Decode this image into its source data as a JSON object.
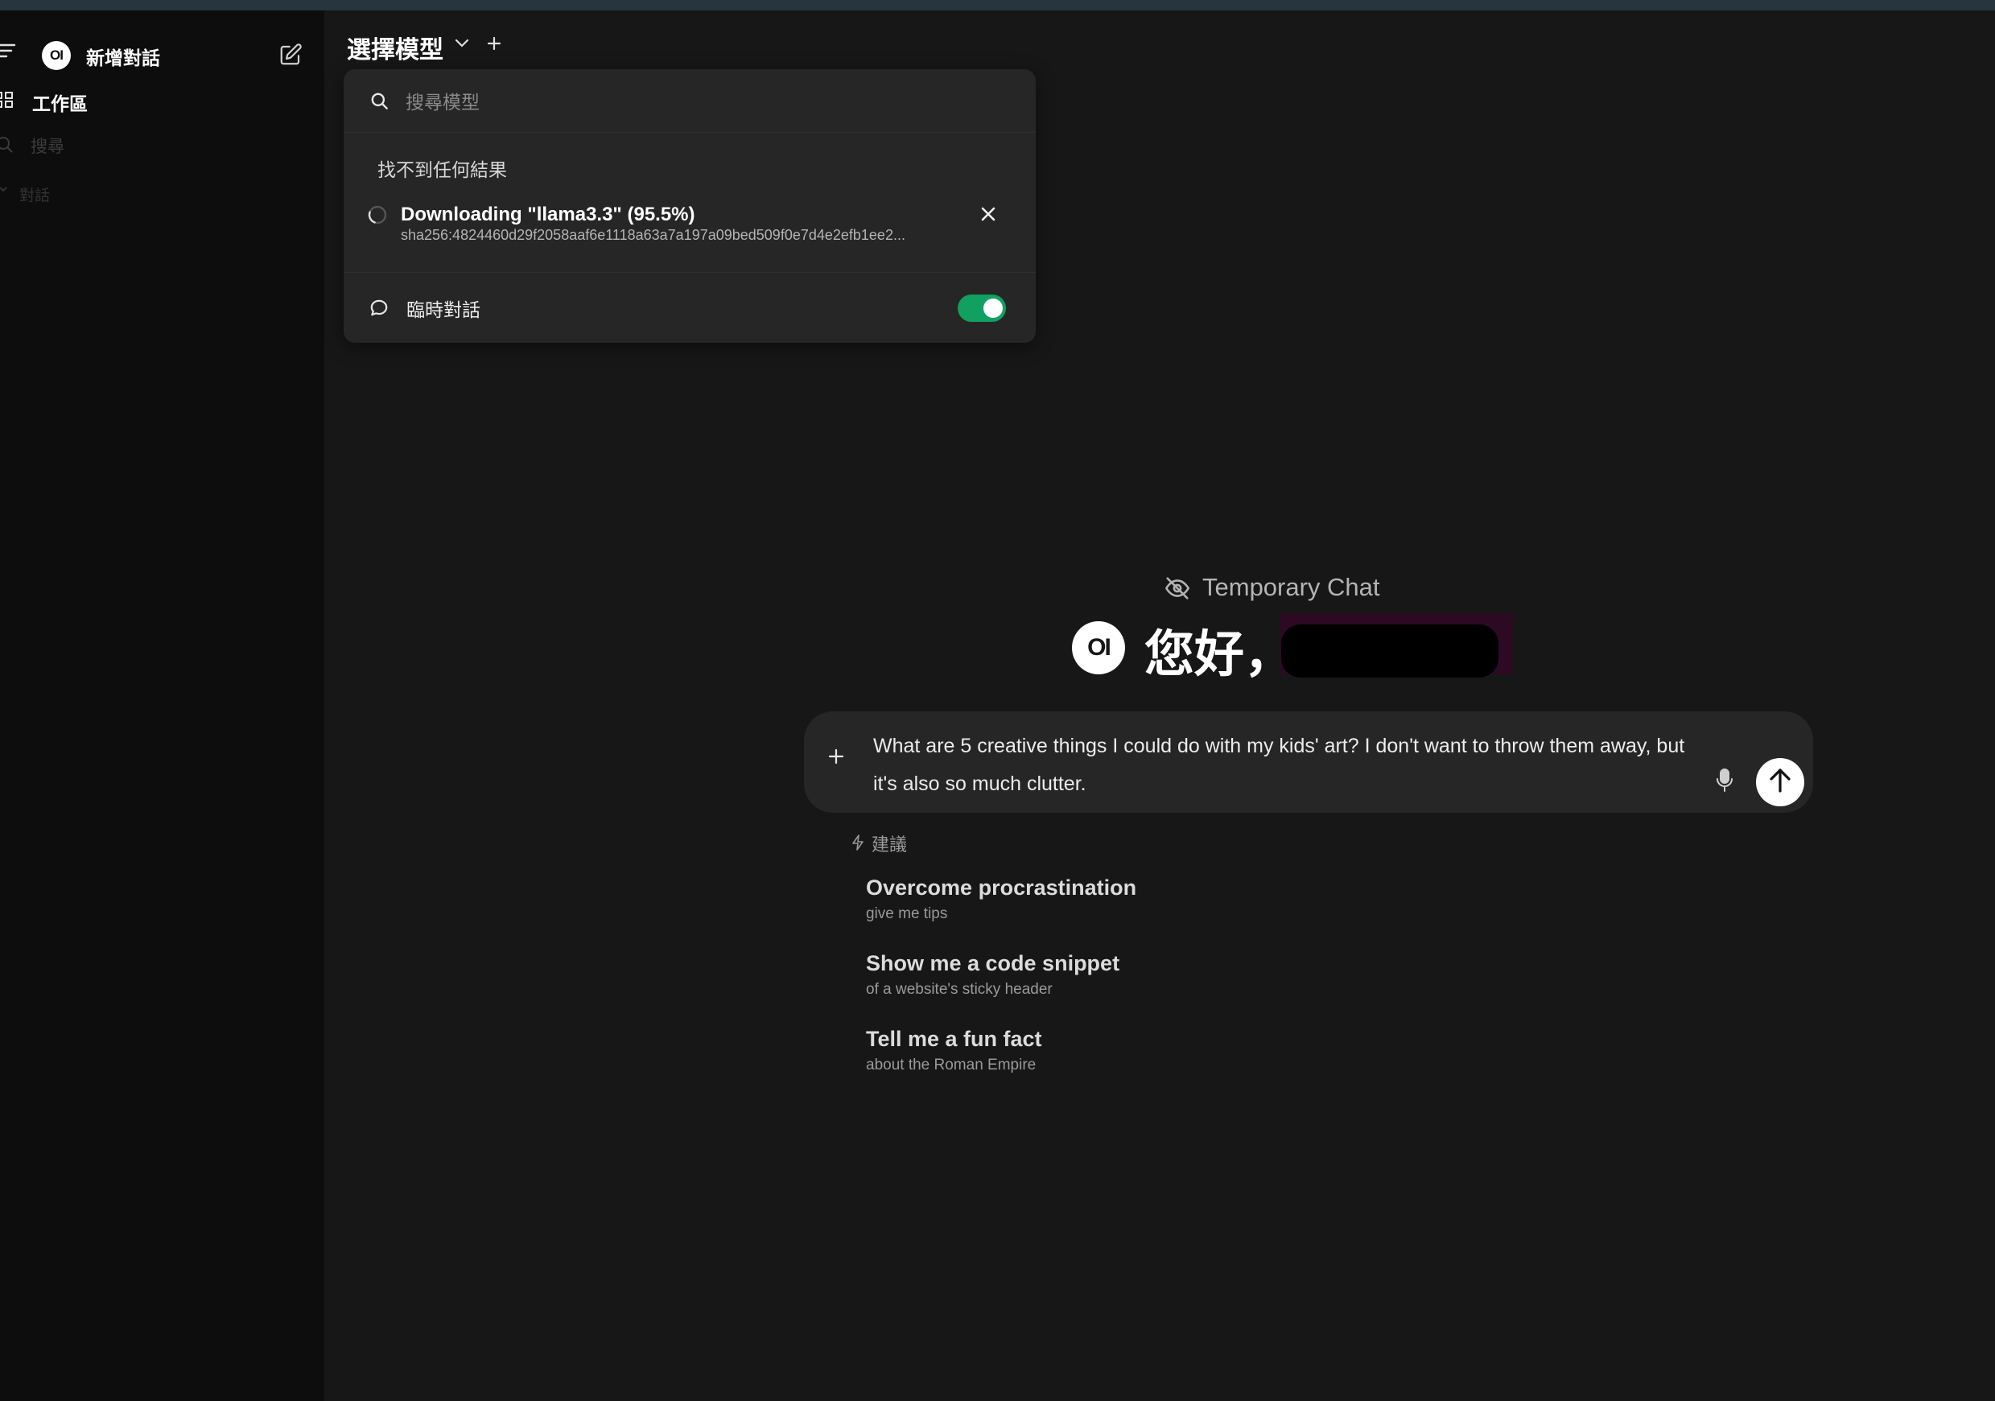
{
  "sidebar": {
    "new_chat_label": "新增對話",
    "logo_text": "OI",
    "workspace_label": "工作區",
    "search_placeholder": "搜尋",
    "chats_section_label": "對話"
  },
  "header": {
    "model_select_label": "選擇模型"
  },
  "model_dropdown": {
    "search_placeholder": "搜尋模型",
    "no_results": "找不到任何結果",
    "download": {
      "label": "Downloading \"llama3.3\" (95.5%)",
      "digest": "sha256:4824460d29f2058aaf6e1118a63a7a197a09bed509f0e7d4e2efb1ee2...",
      "progress_percent": 95.5
    },
    "temporary_chat_label": "臨時對話",
    "temporary_chat_enabled": true
  },
  "main": {
    "temporary_chat_indicator": "Temporary Chat",
    "logo_text": "OI",
    "greeting": "您好，",
    "input_text": "What are 5 creative things I could do with my kids' art? I don't want to throw them away, but it's also so much clutter.",
    "suggestions_header": "建議",
    "suggestions": [
      {
        "title": "Overcome procrastination",
        "subtitle": "give me tips"
      },
      {
        "title": "Show me a code snippet",
        "subtitle": "of a website's sticky header"
      },
      {
        "title": "Tell me a fun fact",
        "subtitle": "about the Roman Empire"
      }
    ]
  },
  "colors": {
    "background": "#171717",
    "sidebar": "#0d0d0d",
    "panel": "#262626",
    "toggle_on": "#10a060",
    "redaction": "#000000"
  },
  "icons": [
    "menu-icon",
    "pencil-square-icon",
    "grid-icon",
    "search-icon",
    "chevron-down-icon",
    "plus-icon",
    "spinner-icon",
    "close-icon",
    "chat-bubble-icon",
    "eye-off-icon",
    "microphone-icon",
    "arrow-up-icon",
    "bolt-icon"
  ]
}
